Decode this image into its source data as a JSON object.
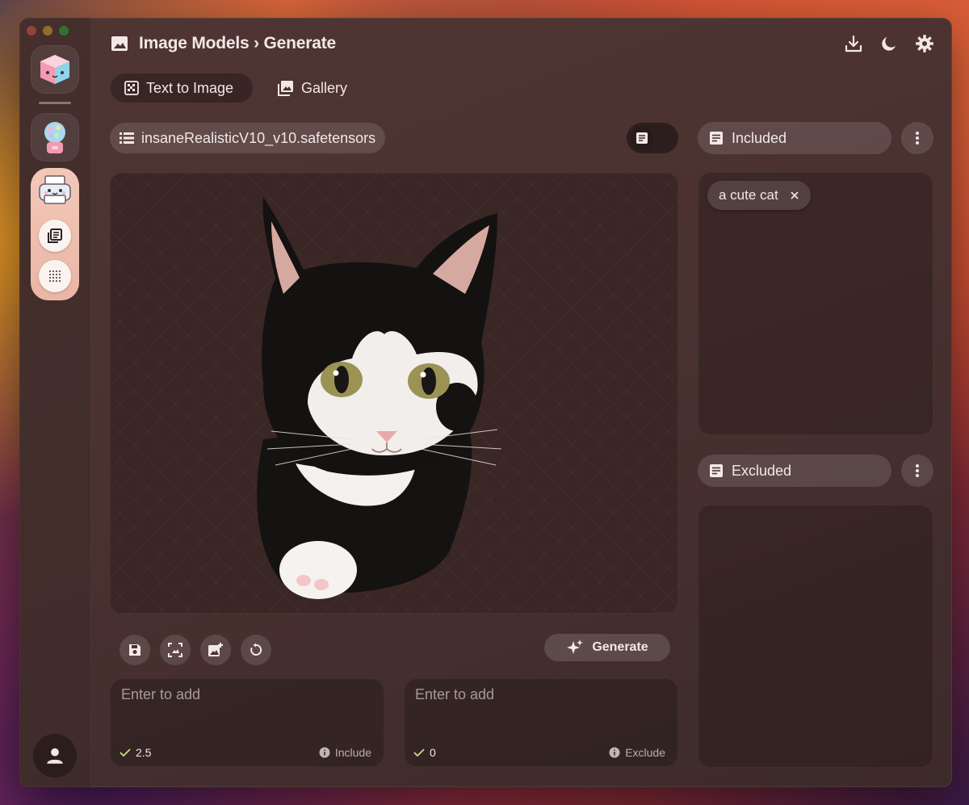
{
  "header": {
    "section": "Image Models",
    "separator": "›",
    "page": "Generate"
  },
  "tabs": [
    {
      "label": "Text to Image",
      "active": true
    },
    {
      "label": "Gallery",
      "active": false
    }
  ],
  "model": {
    "name": "insaneRealisticV10_v10.safetensors"
  },
  "generate": {
    "label": "Generate"
  },
  "prompts": {
    "include": {
      "placeholder": "Enter to add",
      "weight": "2.5",
      "label": "Include"
    },
    "exclude": {
      "placeholder": "Enter to add",
      "weight": "0",
      "label": "Exclude"
    }
  },
  "panels": {
    "included": {
      "title": "Included",
      "tags": [
        "a cute cat"
      ]
    },
    "excluded": {
      "title": "Excluded",
      "tags": []
    }
  },
  "colors": {
    "accent_check": "#c8e07a",
    "traffic_red": "#ff5f57",
    "traffic_yellow": "#febc2e",
    "traffic_green": "#28c840"
  },
  "icons": {
    "header": [
      "image-icon",
      "download-icon",
      "moon-icon",
      "gear-icon"
    ],
    "tools": [
      "save-icon",
      "crop-icon",
      "add-image-icon",
      "reset-icon"
    ]
  }
}
